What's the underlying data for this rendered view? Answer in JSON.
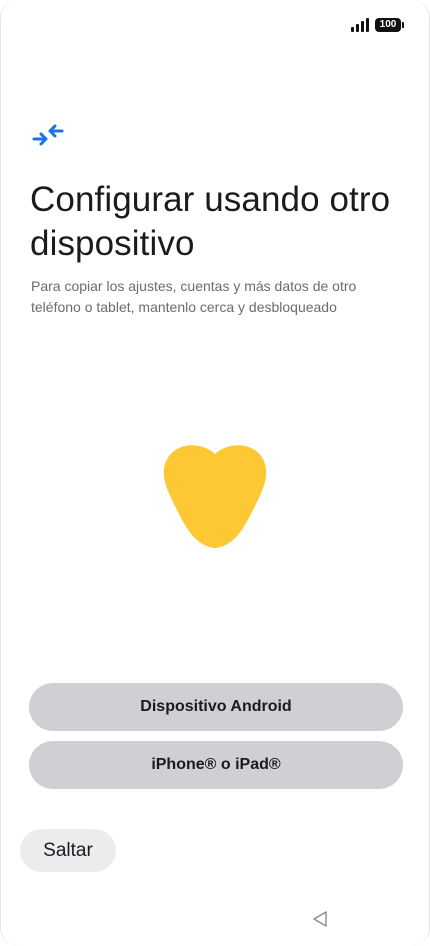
{
  "status_bar": {
    "battery_level": "100",
    "signal_icon": "signal-bars-icon"
  },
  "header": {
    "icon": "transfer-arrows-icon",
    "icon_color": "#1a73e8",
    "title": "Configurar usando otro dispositivo",
    "subtitle": "Para copiar los ajustes, cuentas y más datos de otro teléfono o tablet, mantenlo cerca y desbloqueado"
  },
  "illustration": {
    "icon": "yellow-heart-shape",
    "color": "#fdc834"
  },
  "options": {
    "android_label": "Dispositivo Android",
    "ios_label": "iPhone® o iPad®"
  },
  "footer": {
    "skip_label": "Saltar"
  },
  "navigation": {
    "back_icon": "nav-back-triangle-icon"
  },
  "colors": {
    "button_bg": "#cfd0d4",
    "skip_bg": "#ececef",
    "text": "#1b1b1f",
    "subtitle": "#6b6b72"
  }
}
